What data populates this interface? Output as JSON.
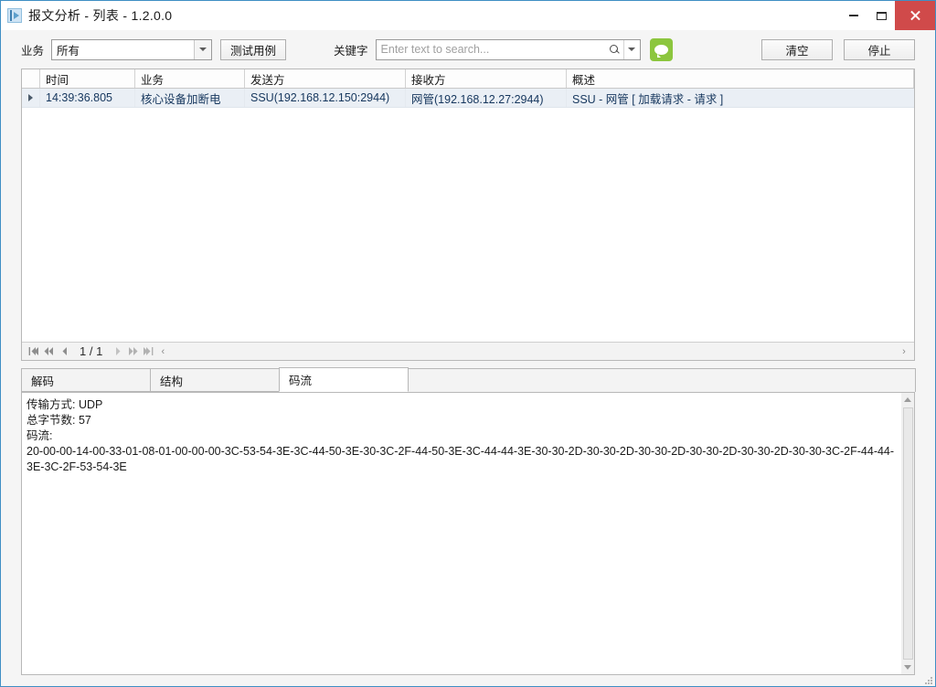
{
  "window": {
    "title": "报文分析 - 列表  -  1.2.0.0",
    "app_icon": "app-chart-icon",
    "minimize_label": "minimize-icon",
    "maximize_label": "maximize-icon",
    "close_label": "close-icon",
    "border_color": "#3f8fc4",
    "close_color": "#d04a4a"
  },
  "toolbar": {
    "service_label": "业务",
    "service_value": "所有",
    "service_options": [
      "所有"
    ],
    "testcase_button": "测试用例",
    "keyword_label": "关键字",
    "search_value": "",
    "search_placeholder": "Enter text to search...",
    "search_icon": "magnifier-icon",
    "search_dropdown_icon": "chevron-down-icon",
    "chat_icon": "speech-bubble-icon",
    "chat_icon_color": "#8cc63e",
    "clear_button": "清空",
    "stop_button": "停止"
  },
  "grid": {
    "columns": [
      "时间",
      "业务",
      "发送方",
      "接收方",
      "概述"
    ],
    "rows": [
      {
        "selected": true,
        "time": "14:39:36.805",
        "service": "核心设备加断电",
        "sender": "SSU(192.168.12.150:2944)",
        "receiver": "网管(192.168.12.27:2944)",
        "summary": "SSU - 网管 [ 加载请求 - 请求 ]"
      }
    ],
    "selected_row_color": "#eaeff5",
    "row_text_color": "#15365d"
  },
  "pager": {
    "first_icon": "page-first-icon",
    "prev_page_icon": "page-prev-block-icon",
    "prev_icon": "page-prev-icon",
    "page_label": "1 / 1",
    "next_icon": "page-next-icon",
    "next_page_icon": "page-next-block-icon",
    "last_icon": "page-last-icon",
    "collapse_icon": "‹",
    "expand_icon": "›"
  },
  "tabs": {
    "items": [
      {
        "label": "解码",
        "active": false
      },
      {
        "label": "结构",
        "active": false
      },
      {
        "label": "码流",
        "active": true
      }
    ]
  },
  "detail": {
    "lines": [
      "传输方式: UDP",
      "总字节数: 57",
      "码流:"
    ],
    "hex": "20-00-00-14-00-33-01-08-01-00-00-00-3C-53-54-3E-3C-44-50-3E-30-3C-2F-44-50-3E-3C-44-44-3E-30-30-2D-30-30-2D-30-30-2D-30-30-2D-30-30-2D-30-30-3C-2F-44-44-3E-3C-2F-53-54-3E",
    "scroll_up_icon": "scroll-up-arrow-icon",
    "scroll_down_icon": "scroll-down-arrow-icon"
  }
}
